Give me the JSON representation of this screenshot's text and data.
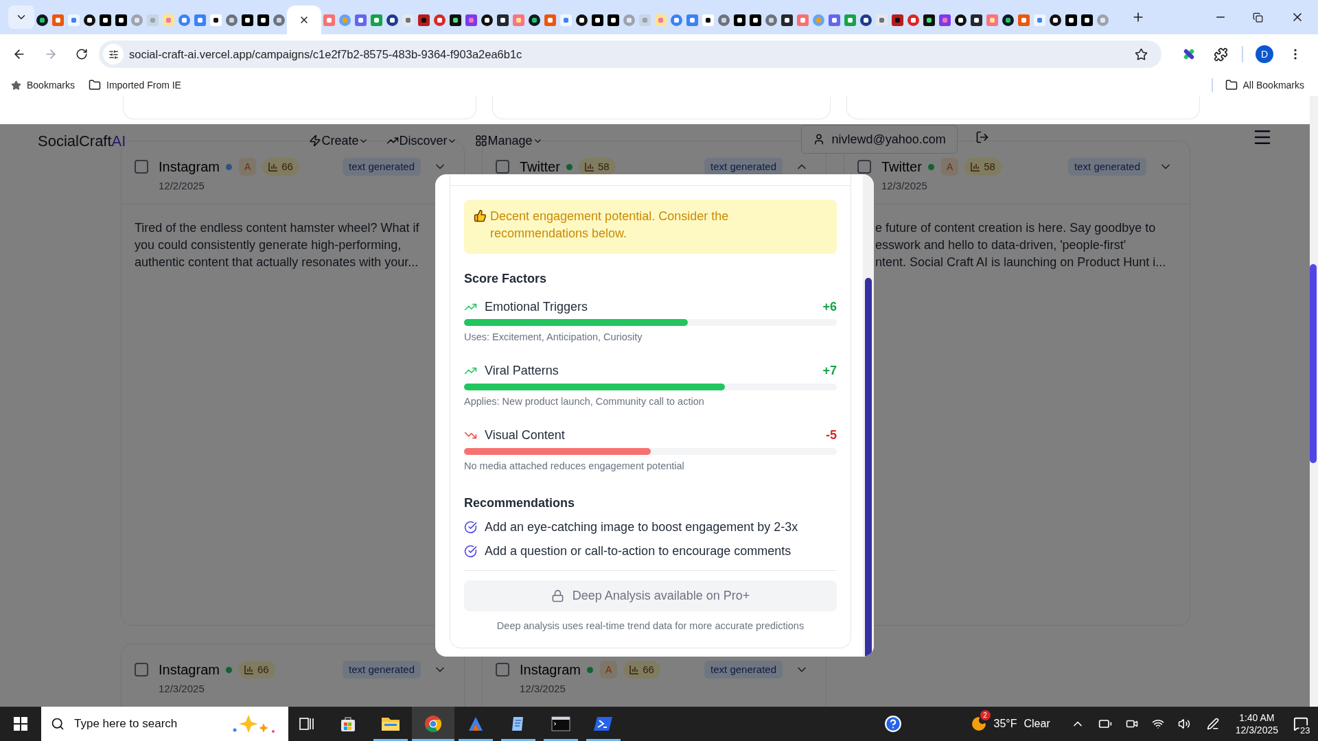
{
  "browser": {
    "tabs": [
      {
        "selected": false
      },
      {
        "selected": false
      },
      {
        "selected": false
      },
      {
        "selected": false
      },
      {
        "selected": false
      },
      {
        "selected": false
      },
      {
        "selected": false
      },
      {
        "selected": false
      },
      {
        "selected": false
      },
      {
        "selected": false
      },
      {
        "selected": false
      },
      {
        "selected": false
      },
      {
        "selected": false
      },
      {
        "selected": false
      },
      {
        "selected": false
      },
      {
        "selected": false
      },
      {
        "selected": true
      },
      {
        "selected": false
      },
      {
        "selected": false
      },
      {
        "selected": false
      },
      {
        "selected": false
      },
      {
        "selected": false
      },
      {
        "selected": false
      },
      {
        "selected": false
      },
      {
        "selected": false
      },
      {
        "selected": false
      },
      {
        "selected": false
      },
      {
        "selected": false
      },
      {
        "selected": false
      },
      {
        "selected": false
      },
      {
        "selected": false
      },
      {
        "selected": false
      },
      {
        "selected": false
      },
      {
        "selected": false
      },
      {
        "selected": false
      },
      {
        "selected": false
      },
      {
        "selected": false
      },
      {
        "selected": false
      },
      {
        "selected": false
      },
      {
        "selected": false
      },
      {
        "selected": false
      },
      {
        "selected": false
      },
      {
        "selected": false
      },
      {
        "selected": false
      },
      {
        "selected": false
      },
      {
        "selected": false
      },
      {
        "selected": false
      },
      {
        "selected": false
      },
      {
        "selected": false
      },
      {
        "selected": false
      },
      {
        "selected": false
      },
      {
        "selected": false
      },
      {
        "selected": false
      },
      {
        "selected": false
      },
      {
        "selected": false
      },
      {
        "selected": false
      },
      {
        "selected": false
      },
      {
        "selected": false
      },
      {
        "selected": false
      },
      {
        "selected": false
      },
      {
        "selected": false
      },
      {
        "selected": false
      },
      {
        "selected": false
      },
      {
        "selected": false
      },
      {
        "selected": false
      },
      {
        "selected": false
      },
      {
        "selected": false
      }
    ],
    "address": "social-craft-ai.vercel.app/campaigns/c1e2f7b2-8575-483b-9364-f903a2ea6b1c",
    "profile_initial": "D",
    "bookmarks": [
      {
        "kind": "star",
        "label": "Bookmarks"
      },
      {
        "kind": "folder",
        "label": "Imported From IE"
      }
    ],
    "all_bookmarks": "All Bookmarks"
  },
  "app": {
    "brand": "SocialCraft",
    "brand_accent": "AI",
    "nav": [
      {
        "kind": "create",
        "label": "Create"
      },
      {
        "kind": "discover",
        "label": "Discover"
      },
      {
        "kind": "manage",
        "label": "Manage"
      }
    ],
    "user_email": "nivlewd@yahoo.com"
  },
  "cards": [
    {
      "platform": "Instagram",
      "color": "#30527d",
      "ai_badge": "A",
      "score": "66",
      "status": "text generated",
      "expanded": false,
      "checked": false,
      "date": "12/2/2025",
      "body_lines": [
        "Tired of the endless content hamster wheel? What if",
        "you could consistently generate high-performing,",
        "authentic content that actually resonates with your..."
      ]
    },
    {
      "platform": "Twitter",
      "color": "#11622f",
      "score": "58",
      "status": "text generated",
      "expanded": true,
      "checked": false
    },
    {
      "platform": "Twitter",
      "color": "#11622f",
      "ai_badge": "A",
      "score": "58",
      "status": "text generated",
      "expanded": false,
      "checked": false,
      "date": "12/3/2025",
      "body_lines": [
        "e future of content creation is here. Say goodbye to",
        "esswork and hello to data-driven, 'people-first'",
        "ntent. Social Craft AI is launching on Product Hunt i..."
      ]
    },
    {
      "platform": "Instagram",
      "color": "#11622f",
      "score": "66",
      "status": "text generated",
      "expanded": false,
      "checked": false,
      "date": "12/3/2025"
    },
    {
      "platform": "Instagram",
      "color": "#11622f",
      "ai_badge": "A",
      "score": "66",
      "status": "text generated",
      "expanded": false,
      "checked": false,
      "date": "12/3/2025"
    }
  ],
  "modal": {
    "alert": "Decent engagement potential. Consider the recommendations below.",
    "factors_title": "Score Factors",
    "factors": [
      {
        "name": "Emotional Triggers",
        "value": "+6",
        "kind": "up",
        "level": 0.6,
        "note": "Uses: Excitement, Anticipation, Curiosity"
      },
      {
        "name": "Viral Patterns",
        "value": "+7",
        "kind": "up",
        "level": 0.7,
        "note": "Applies: New product launch, Community call to action"
      },
      {
        "name": "Visual Content",
        "value": "-5",
        "kind": "down",
        "level": 0.5,
        "note": "No media attached reduces engagement potential"
      }
    ],
    "recommendations_title": "Recommendations",
    "recommendations": [
      "Add an eye-catching image to boost engagement by 2-3x",
      "Add a question or call-to-action to encourage comments"
    ],
    "pro_button": {
      "label": "Deep Analysis available on Pro+",
      "disabled": true
    },
    "footnote": "Deep analysis uses real-time trend data for more accurate predictions"
  },
  "taskbar": {
    "search_placeholder": "Type here to search",
    "apps": [
      {
        "kind": "store",
        "running": false,
        "selected": false
      },
      {
        "kind": "explorer",
        "running": true,
        "selected": false
      },
      {
        "kind": "chrome",
        "running": true,
        "selected": true
      },
      {
        "kind": "editor",
        "running": true,
        "selected": false
      },
      {
        "kind": "notes",
        "running": true,
        "selected": false
      },
      {
        "kind": "terminal",
        "running": true,
        "selected": false
      },
      {
        "kind": "powershell",
        "running": true,
        "selected": false
      }
    ],
    "weather_badge": "2",
    "temperature": "35°F",
    "condition": "Clear",
    "time": "1:40 AM",
    "date": "12/3/2025",
    "notifications": "23"
  }
}
